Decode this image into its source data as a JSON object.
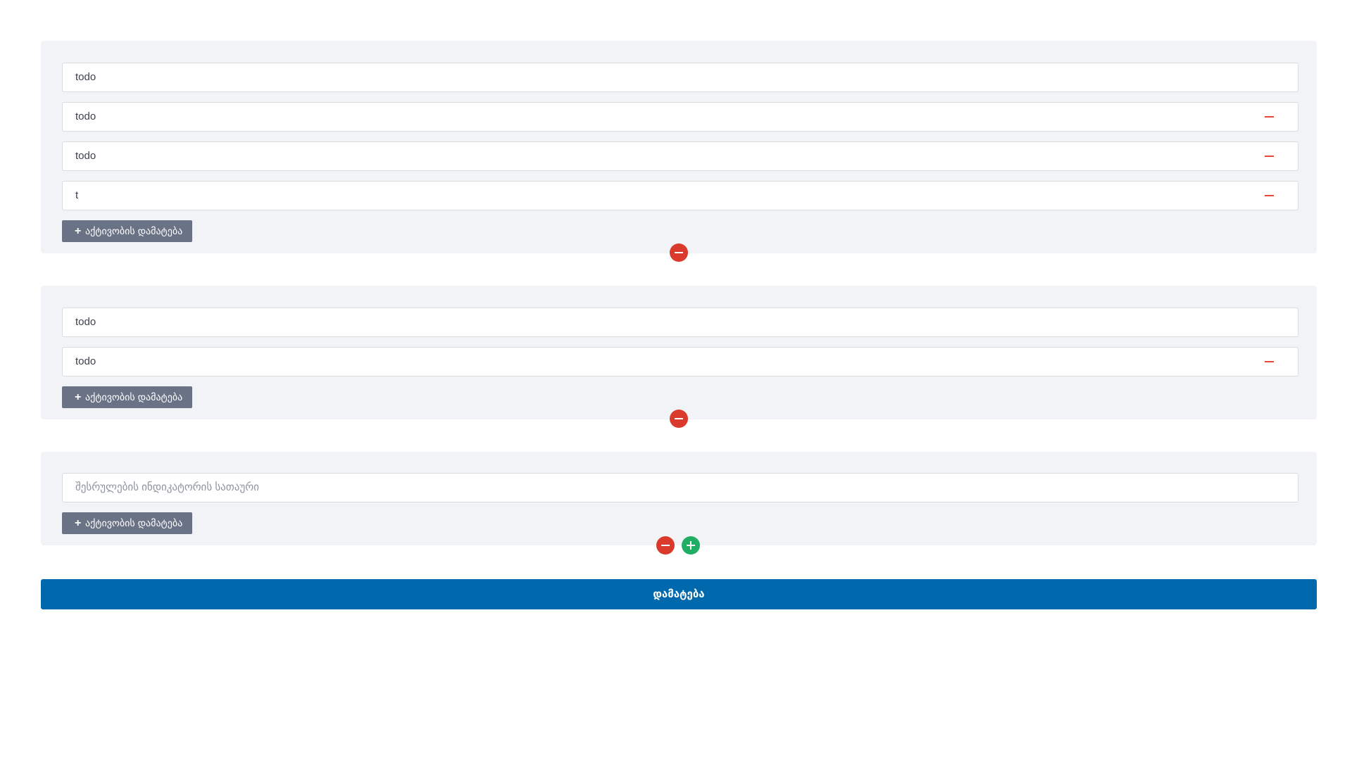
{
  "groups": [
    {
      "fields": [
        {
          "value": "todo",
          "removable": false
        },
        {
          "value": "todo",
          "removable": true
        },
        {
          "value": "todo",
          "removable": true
        },
        {
          "value": "t",
          "removable": true
        }
      ],
      "add_activity_label": "აქტივობის დამატება"
    },
    {
      "fields": [
        {
          "value": "todo",
          "removable": false
        },
        {
          "value": "todo",
          "removable": true
        }
      ],
      "add_activity_label": "აქტივობის დამატება"
    },
    {
      "fields": [
        {
          "value": "",
          "placeholder": "შესრულების ინდიკატორის სათაური",
          "removable": false
        }
      ],
      "add_activity_label": "აქტივობის დამატება"
    }
  ],
  "add_activity_icon": "+",
  "submit_label": "დამატება",
  "colors": {
    "panel_bg": "#f2f3f6",
    "remove": "#d93a2b",
    "add": "#1fae63",
    "secondary_button": "#6a7285",
    "primary": "#0068ac"
  },
  "icons": {
    "remove_field": "minus-icon",
    "remove_group": "minus-circle-icon",
    "add_group": "plus-circle-icon",
    "add_activity": "plus-icon"
  }
}
